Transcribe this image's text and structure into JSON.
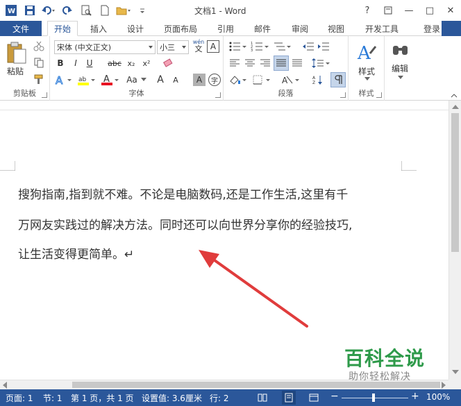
{
  "window": {
    "title": "文档1 - Word",
    "help": "?",
    "minimize": "—",
    "maximize": "□",
    "close": "✕"
  },
  "tabs": {
    "file": "文件",
    "items": [
      "开始",
      "插入",
      "设计",
      "页面布局",
      "引用",
      "邮件",
      "审阅",
      "视图",
      "开发工具"
    ],
    "active": "开始",
    "login": "登录"
  },
  "ribbon": {
    "clipboard": {
      "label": "剪贴板",
      "paste": "粘贴"
    },
    "font": {
      "label": "字体",
      "font_name": "宋体 (中文正文)",
      "font_size": "小三",
      "wen": "wén",
      "wen_char": "文",
      "bold": "B",
      "italic": "I",
      "underline": "U",
      "strike": "abc",
      "sub": "x₂",
      "sup": "x²",
      "clear": "A",
      "aa": "Aa",
      "grow": "A",
      "shrink": "A",
      "shade": "A",
      "circle": "字"
    },
    "paragraph": {
      "label": "段落"
    },
    "styles": {
      "label": "样式",
      "styles_btn": "样式"
    },
    "editing": {
      "label": "编辑"
    }
  },
  "document": {
    "lines": [
      "搜狗指南,指到就不难。不论是电脑数码,还是工作生活,这里有千",
      "万网友实践过的解决方法。同时还可以向世界分享你的经验技巧,",
      "让生活变得更简单。↵"
    ]
  },
  "status": {
    "page": "页面: 1",
    "section": "节: 1",
    "pages": "第 1 页，共 1 页",
    "position": "设置值: 3.6厘米",
    "line": "行: 2",
    "zoom": "100%"
  },
  "watermark": {
    "title": "百科全说",
    "sub": "助你轻松解决"
  },
  "colors": {
    "accent": "#2b579a",
    "arrow": "#e03c3c",
    "watermark": "#2e9a4a"
  }
}
